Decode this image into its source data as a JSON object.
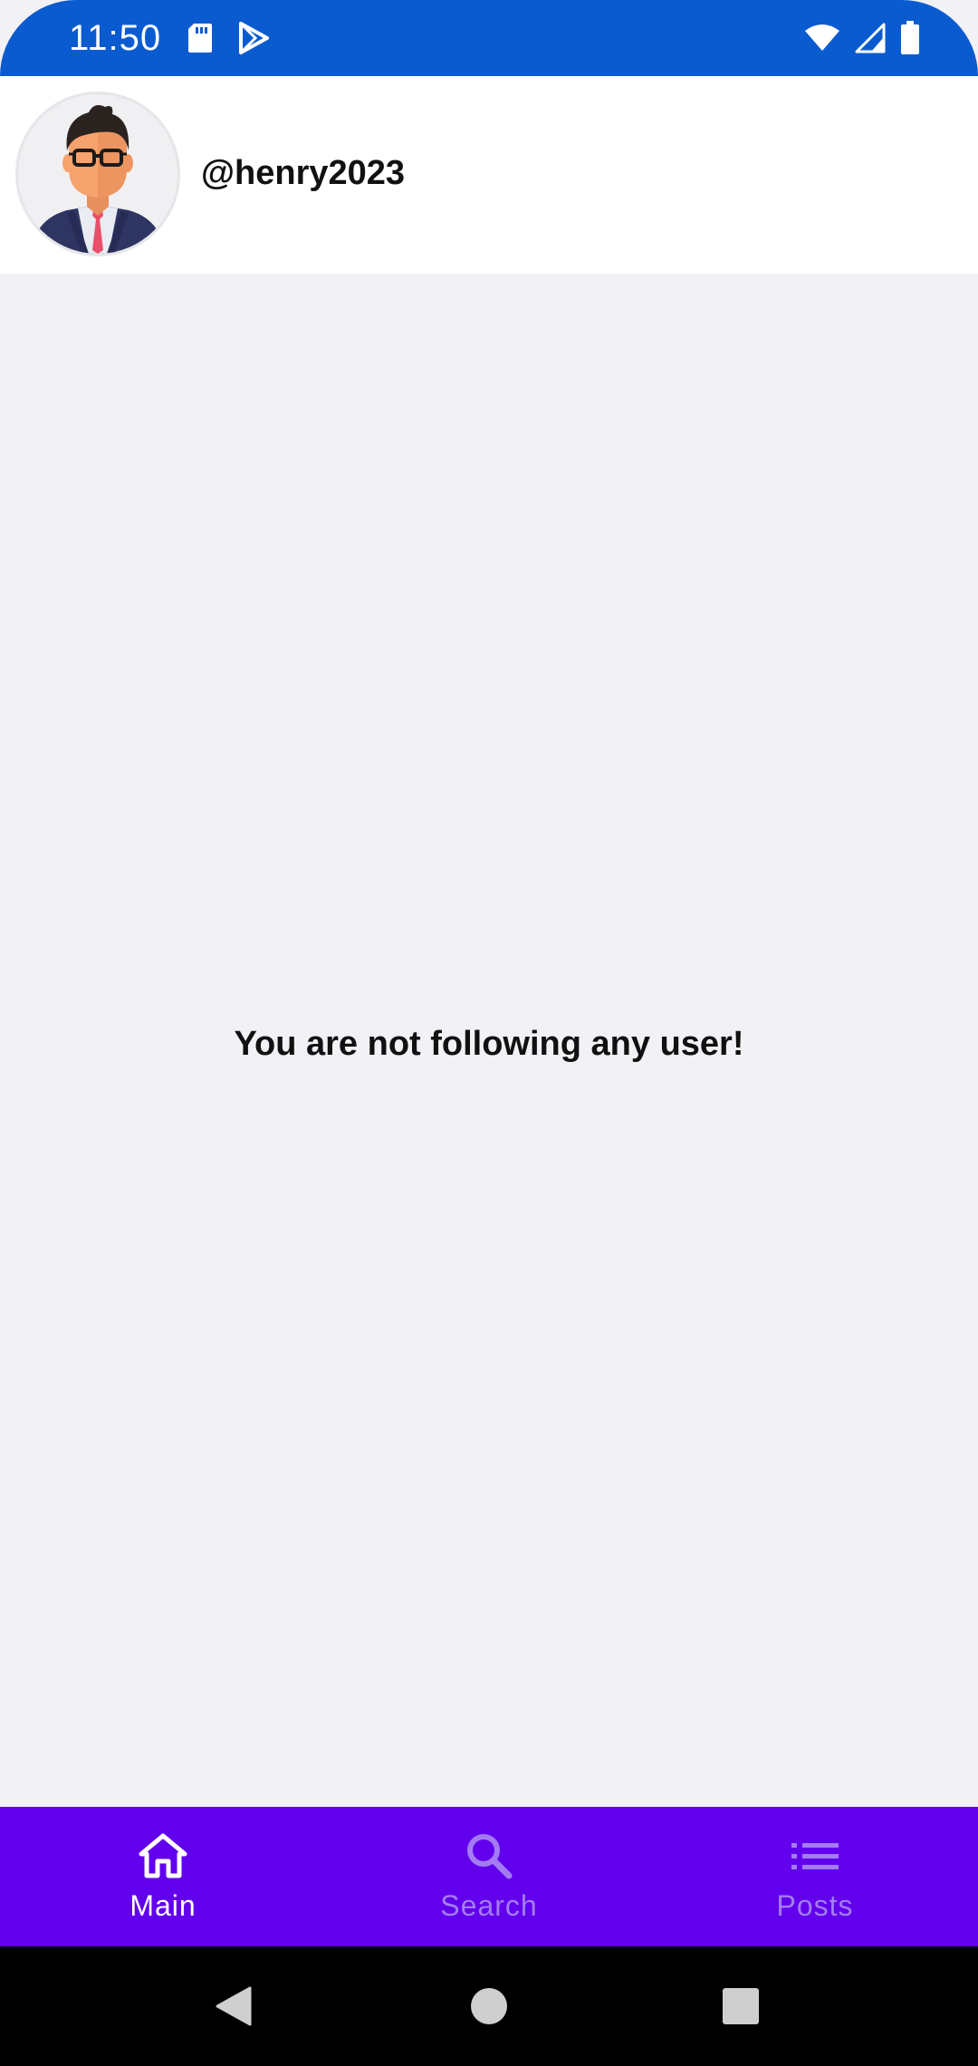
{
  "status_bar": {
    "time": "11:50",
    "left_icons": [
      "sd-card-icon",
      "play-store-icon"
    ],
    "right_icons": [
      "wifi-icon",
      "cell-signal-icon",
      "battery-icon"
    ],
    "background_color": "#0b5bd0"
  },
  "header": {
    "avatar_icon": "avatar-man-with-glasses",
    "username": "@henry2023"
  },
  "main": {
    "empty_message": "You are not following any user!"
  },
  "bottom_nav": {
    "background_color": "#6200ee",
    "items": [
      {
        "label": "Main",
        "icon": "home-icon",
        "active": true
      },
      {
        "label": "Search",
        "icon": "search-icon",
        "active": false
      },
      {
        "label": "Posts",
        "icon": "list-icon",
        "active": false
      }
    ]
  },
  "system_nav": {
    "buttons": [
      "back-icon",
      "home-circle-icon",
      "recents-icon"
    ]
  }
}
